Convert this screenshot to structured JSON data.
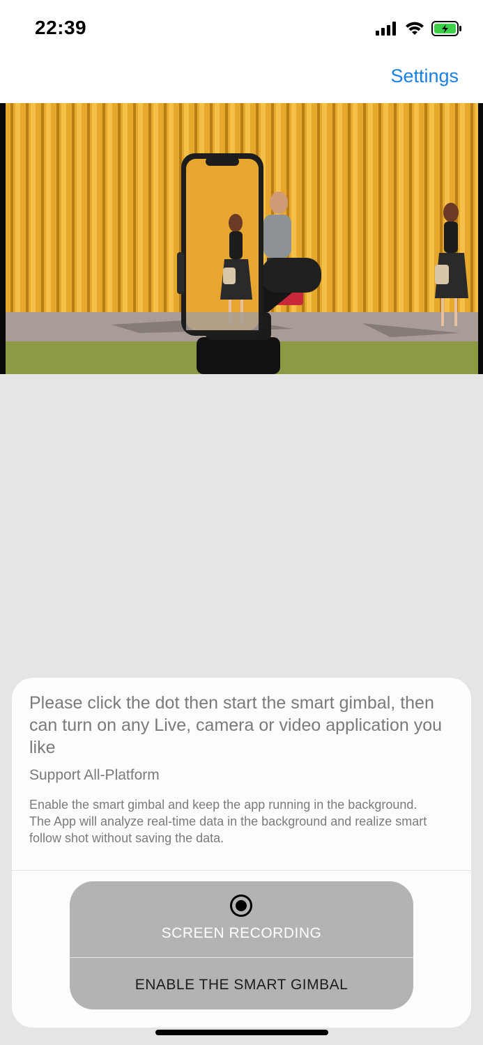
{
  "status_bar": {
    "time": "22:39",
    "icons": [
      "cellular-signal-icon",
      "wifi-icon",
      "battery-charging-icon"
    ],
    "battery_color": "#3ecf4a"
  },
  "nav": {
    "settings_label": "Settings",
    "accent_color": "#1a7fe3"
  },
  "hero": {
    "image": "promo-photo-smart-gimbal"
  },
  "sheet": {
    "title": "Please click the dot then start the smart gimbal, then can turn on any Live, camera or video application you like",
    "subtitle": "Support All-Platform",
    "description": "Enable the smart gimbal and keep the app running in the background. The App will analyze real-time data in the background and realize smart follow shot without saving the data.",
    "buttons": {
      "record_label": "SCREEN RECORDING",
      "record_icon": "record-dot-icon",
      "enable_label": "ENABLE THE SMART GIMBAL"
    }
  }
}
